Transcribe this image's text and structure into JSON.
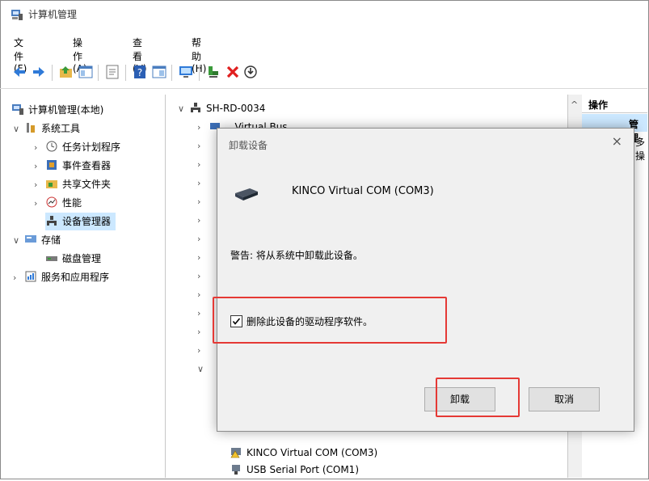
{
  "window": {
    "title": "计算机管理"
  },
  "menu": [
    "文件(F)",
    "操作(A)",
    "查看(V)",
    "帮助(H)"
  ],
  "tree": [
    {
      "label": "计算机管理(本地)",
      "icon": "computer-management-icon"
    },
    {
      "label": "系统工具",
      "icon": "system-tools-icon"
    },
    {
      "label": "任务计划程序",
      "icon": "task-scheduler-icon"
    },
    {
      "label": "事件查看器",
      "icon": "event-viewer-icon"
    },
    {
      "label": "共享文件夹",
      "icon": "shared-folders-icon"
    },
    {
      "label": "性能",
      "icon": "performance-icon"
    },
    {
      "label": "设备管理器",
      "icon": "device-manager-icon"
    },
    {
      "label": "存储",
      "icon": "storage-icon"
    },
    {
      "label": "磁盘管理",
      "icon": "disk-management-icon"
    },
    {
      "label": "服务和应用程序",
      "icon": "services-apps-icon"
    }
  ],
  "devices": {
    "root": "SH-RD-0034",
    "partial_child": "...Virtual Bus...",
    "visible_children": [
      {
        "label": "KINCO Virtual COM (COM3)",
        "icon": "warning-port-icon"
      },
      {
        "label": "USB Serial Port (COM1)",
        "icon": "port-icon"
      }
    ]
  },
  "actions": {
    "header": "操作",
    "item1": "管理",
    "item2": "多操"
  },
  "dialog": {
    "title": "卸载设备",
    "device_name": "KINCO Virtual COM (COM3)",
    "warning": "警告: 将从系统中卸载此设备。",
    "checkbox_label": "删除此设备的驱动程序软件。",
    "checkbox_checked": true,
    "uninstall_label": "卸载",
    "cancel_label": "取消"
  },
  "colors": {
    "highlight": "#e53935",
    "selection": "#cce8ff"
  }
}
